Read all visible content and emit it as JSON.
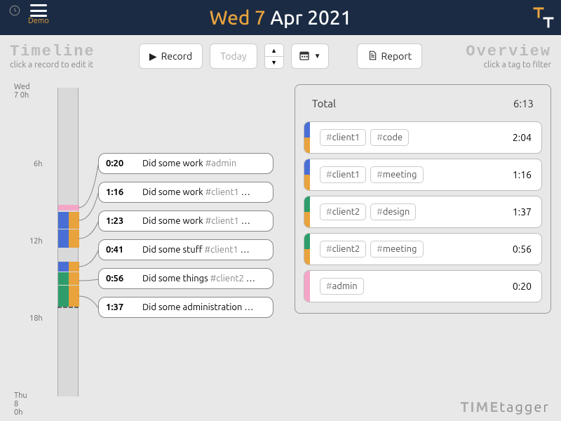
{
  "header": {
    "menu_label": "Demo",
    "date_weekday": "Wed 7",
    "date_rest": " Apr 2021"
  },
  "timeline_panel": {
    "title": "Timeline",
    "subtitle": "click a record to edit it"
  },
  "overview_panel": {
    "title": "Overview",
    "subtitle": "click a tag to filter"
  },
  "buttons": {
    "record": "Record",
    "today": "Today",
    "report": "Report"
  },
  "axis": {
    "start": "Wed 7 0h",
    "h6": "6h",
    "h12": "12h",
    "h18": "18h",
    "end": "Thu 8 0h"
  },
  "records": [
    {
      "duration": "0:20",
      "desc": "Did some work",
      "tags": "#admin",
      "ellipsis": ""
    },
    {
      "duration": "1:16",
      "desc": "Did some work",
      "tags": "#client1",
      "ellipsis": " …"
    },
    {
      "duration": "1:23",
      "desc": "Did some work",
      "tags": "#client1",
      "ellipsis": " …"
    },
    {
      "duration": "0:41",
      "desc": "Did some stuff",
      "tags": "#client1",
      "ellipsis": " …"
    },
    {
      "duration": "0:56",
      "desc": "Did some things",
      "tags": "#client2",
      "ellipsis": " …"
    },
    {
      "duration": "1:37",
      "desc": "Did some administration",
      "tags": "",
      "ellipsis": " …"
    }
  ],
  "overview": {
    "total_label": "Total",
    "total_duration": "6:13",
    "rows": [
      {
        "tags": [
          "client1",
          "code"
        ],
        "duration": "2:04",
        "colors": [
          "c-blue",
          "c-orange"
        ]
      },
      {
        "tags": [
          "client1",
          "meeting"
        ],
        "duration": "1:16",
        "colors": [
          "c-blue",
          "c-orange"
        ]
      },
      {
        "tags": [
          "client2",
          "design"
        ],
        "duration": "1:37",
        "colors": [
          "c-green",
          "c-orange"
        ]
      },
      {
        "tags": [
          "client2",
          "meeting"
        ],
        "duration": "0:56",
        "colors": [
          "c-green",
          "c-orange"
        ]
      },
      {
        "tags": [
          "admin"
        ],
        "duration": "0:20",
        "colors": [
          "c-pink"
        ]
      }
    ]
  },
  "footer": {
    "brand1": "TIME",
    "brand2": "tagger"
  }
}
